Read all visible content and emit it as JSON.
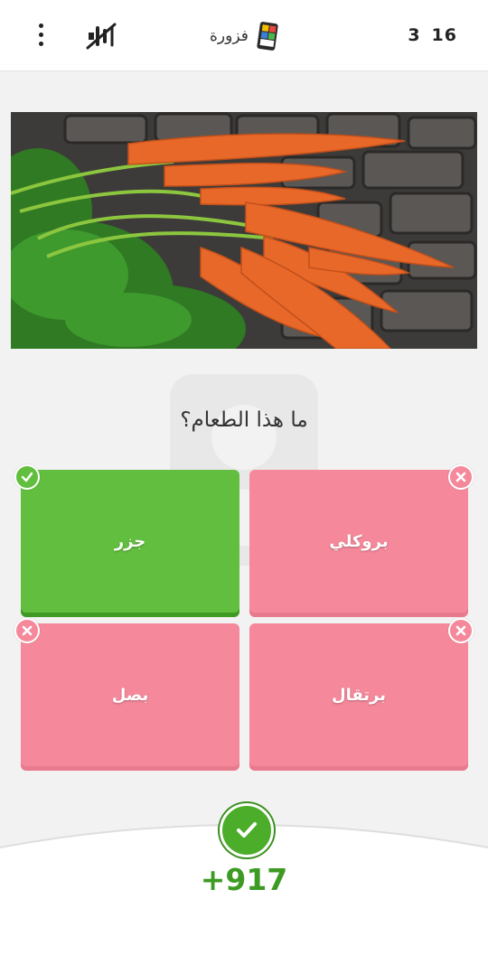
{
  "header": {
    "title": "فزورة",
    "score_round": "3",
    "score_total": "16"
  },
  "quiz": {
    "question": "ما هذا الطعام؟",
    "answers": [
      {
        "label": "جزر",
        "state": "correct"
      },
      {
        "label": "بروكلي",
        "state": "wrong"
      },
      {
        "label": "بصل",
        "state": "wrong"
      },
      {
        "label": "برتقال",
        "state": "wrong"
      }
    ]
  },
  "result": {
    "points": "+917",
    "icon": "check-icon"
  },
  "colors": {
    "correct": "#62be3e",
    "wrong": "#f5899b",
    "points": "#3d9b23"
  }
}
